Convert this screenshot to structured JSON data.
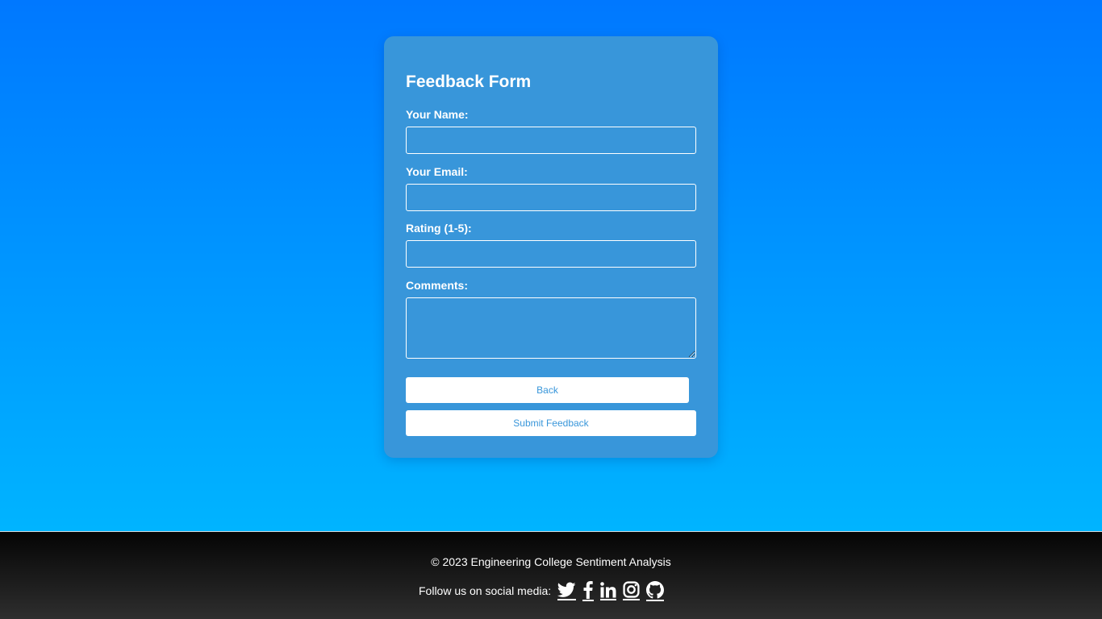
{
  "form": {
    "title": "Feedback Form",
    "name_label": "Your Name:",
    "name_value": "",
    "email_label": "Your Email:",
    "email_value": "",
    "rating_label": "Rating (1-5):",
    "rating_value": "",
    "comments_label": "Comments:",
    "comments_value": "",
    "back_label": "Back",
    "submit_label": "Submit Feedback"
  },
  "footer": {
    "copyright": "© 2023 Engineering College Sentiment Analysis",
    "follow_text": "Follow us on social media:",
    "social": [
      {
        "icon": "twitter-icon"
      },
      {
        "icon": "facebook-icon"
      },
      {
        "icon": "linkedin-icon"
      },
      {
        "icon": "instagram-icon"
      },
      {
        "icon": "github-icon"
      }
    ]
  },
  "colors": {
    "gradient_top": "#0078ff",
    "gradient_bottom": "#00b4ff",
    "card": "#3896da",
    "button_bg": "#ffffff",
    "button_text": "#3896da",
    "footer_top": "#050505",
    "footer_bottom": "#2e2e2e"
  }
}
